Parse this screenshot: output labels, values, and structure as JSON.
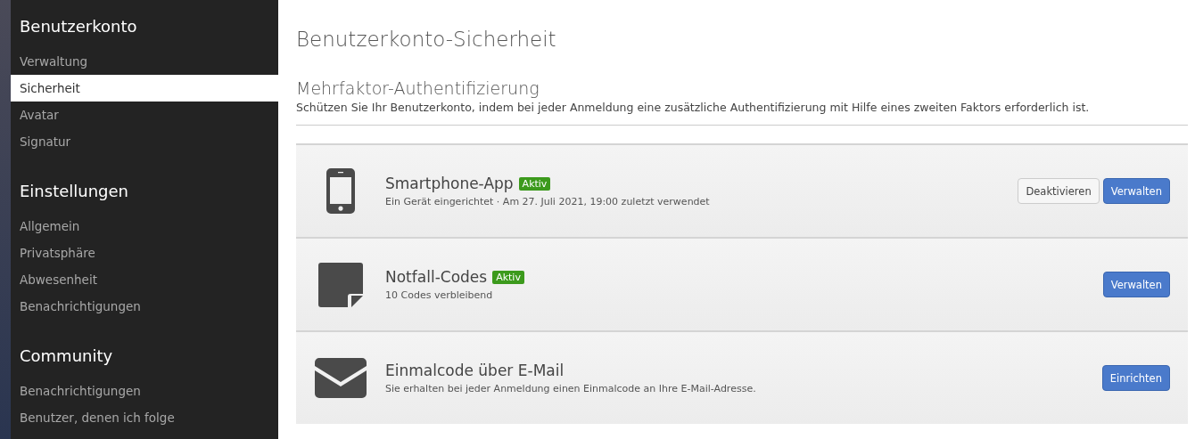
{
  "sidebar": {
    "sections": [
      {
        "heading": "Benutzerkonto",
        "items": [
          {
            "label": "Verwaltung",
            "selected": false
          },
          {
            "label": "Sicherheit",
            "selected": true
          },
          {
            "label": "Avatar",
            "selected": false
          },
          {
            "label": "Signatur",
            "selected": false
          }
        ]
      },
      {
        "heading": "Einstellungen",
        "items": [
          {
            "label": "Allgemein",
            "selected": false
          },
          {
            "label": "Privatsphäre",
            "selected": false
          },
          {
            "label": "Abwesenheit",
            "selected": false
          },
          {
            "label": "Benachrichtigungen",
            "selected": false
          }
        ]
      },
      {
        "heading": "Community",
        "items": [
          {
            "label": "Benachrichtigungen",
            "selected": false
          },
          {
            "label": "Benutzer, denen ich folge",
            "selected": false
          }
        ]
      }
    ]
  },
  "page_title": "Benutzerkonto-Sicherheit",
  "section": {
    "title": "Mehrfaktor-Authentifizierung",
    "description": "Schützen Sie Ihr Benutzerkonto, indem bei jeder Anmeldung eine zusätzliche Authentifizierung mit Hilfe eines zweiten Faktors erforderlich ist."
  },
  "methods": [
    {
      "kind": "phone",
      "name": "Smartphone-App",
      "badge": "Aktiv",
      "detail": "Ein Gerät eingerichtet · Am 27. Juli 2021, 19:00 zuletzt verwendet",
      "buttons": [
        {
          "label": "Deaktivieren",
          "kind": "default"
        },
        {
          "label": "Verwalten",
          "kind": "primary"
        }
      ]
    },
    {
      "kind": "codes",
      "name": "Notfall-Codes",
      "badge": "Aktiv",
      "detail": "10 Codes verbleibend",
      "buttons": [
        {
          "label": "Verwalten",
          "kind": "primary"
        }
      ]
    },
    {
      "kind": "email",
      "name": "Einmalcode über E-Mail",
      "detail": "Sie erhalten bei jeder Anmeldung einen Einmalcode an Ihre E-Mail-Adresse.",
      "buttons": [
        {
          "label": "Einrichten",
          "kind": "primary"
        }
      ]
    }
  ]
}
